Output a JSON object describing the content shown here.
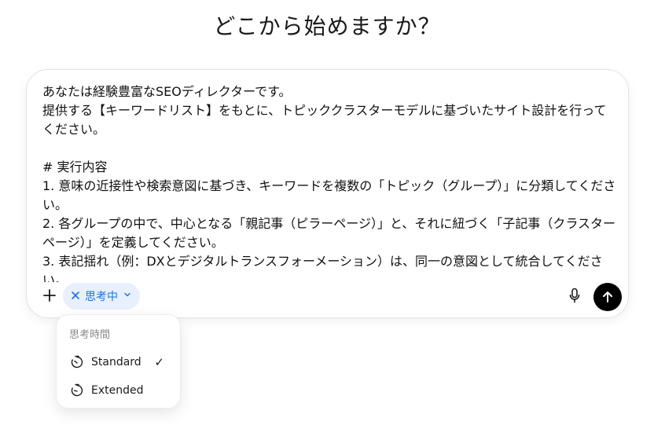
{
  "heading": "どこから始めますか？",
  "composer": {
    "text": "あなたは経験豊富なSEOディレクターです。\n提供する【キーワードリスト】をもとに、トピッククラスターモデルに基づいたサイト設計を行ってください。\n\n# 実行内容\n1. 意味の近接性や検索意図に基づき、キーワードを複数の「トピック（グループ）」に分類してください。\n2. 各グループの中で、中心となる「親記事（ピラーページ）」と、それに紐づく「子記事（クラスターページ）」を定義してください。\n3. 表記揺れ（例：DXとデジタルトランスフォーメーション）は、同一の意図として統合してください。",
    "plus_icon": "plus-icon",
    "think_chip": {
      "label": "思考中",
      "close_icon": "close-icon",
      "chevron_icon": "chevron-down-icon",
      "color": "#1a73e8",
      "background": "#e8f0fe"
    },
    "mic_icon": "microphone-icon",
    "send_icon": "arrow-up-icon"
  },
  "think_menu": {
    "header": "思考時間",
    "items": [
      {
        "label": "Standard",
        "icon": "timer-icon",
        "selected": true
      },
      {
        "label": "Extended",
        "icon": "timer-extended-icon",
        "selected": false
      }
    ],
    "check_mark": "✓"
  }
}
